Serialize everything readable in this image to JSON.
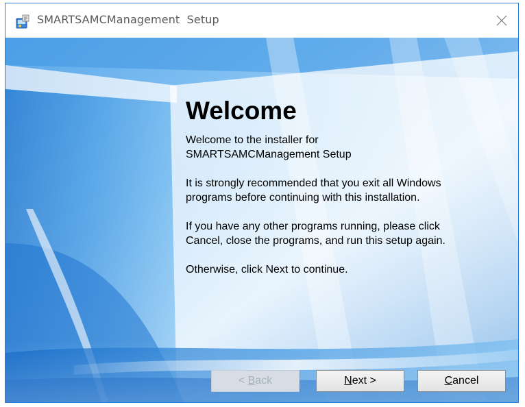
{
  "window": {
    "title": "SMARTSAMCManagement  Setup"
  },
  "page": {
    "heading": "Welcome",
    "paragraphs": [
      "Welcome to the installer for\nSMARTSAMCManagement  Setup",
      "It is strongly recommended that you exit all Windows\nprograms before continuing with this installation.",
      "If you have any other programs running, please click\nCancel, close the programs, and run this setup again.",
      "Otherwise, click Next to continue."
    ]
  },
  "buttons": {
    "back": {
      "access_key": "<",
      "rest": " Back",
      "display": "< Back",
      "accel_letter": "B",
      "enabled": false
    },
    "next": {
      "accel": "N",
      "rest": "ext >",
      "enabled": true
    },
    "cancel": {
      "accel": "C",
      "rest": "ancel",
      "enabled": true
    }
  },
  "icons": {
    "app": "installer-icon",
    "close": "close-icon"
  },
  "colors": {
    "window_border": "#2b7bd9",
    "title_text": "#5a5a5a",
    "background_accent": "#1e7fd8"
  }
}
